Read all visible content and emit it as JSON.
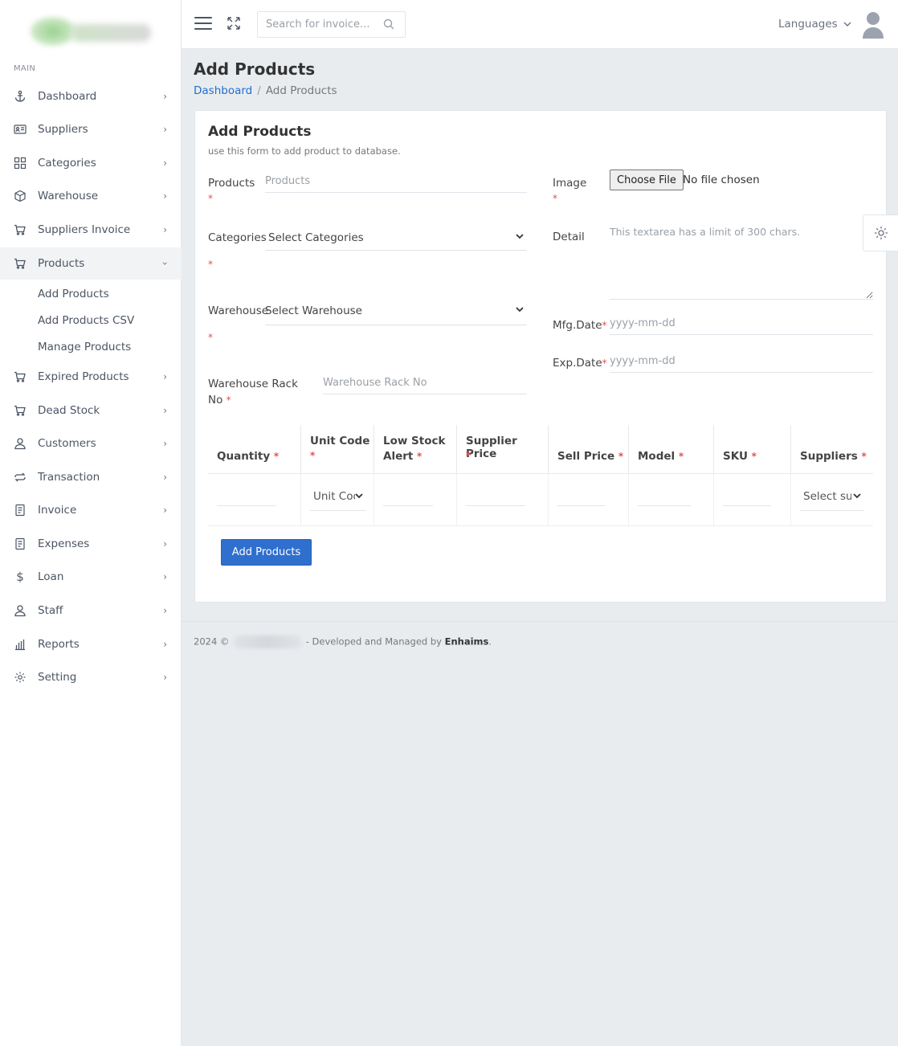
{
  "sidebar": {
    "section_label": "MAIN",
    "items": [
      {
        "label": "Dashboard",
        "icon": "anchor-icon"
      },
      {
        "label": "Suppliers",
        "icon": "id-card-icon"
      },
      {
        "label": "Categories",
        "icon": "grid-icon"
      },
      {
        "label": "Warehouse",
        "icon": "box-icon"
      },
      {
        "label": "Suppliers Invoice",
        "icon": "cart-icon"
      },
      {
        "label": "Products",
        "icon": "cart-icon"
      },
      {
        "label": "Expired Products",
        "icon": "cart-icon"
      },
      {
        "label": "Dead Stock",
        "icon": "cart-icon"
      },
      {
        "label": "Customers",
        "icon": "user-icon"
      },
      {
        "label": "Transaction",
        "icon": "transfer-icon"
      },
      {
        "label": "Invoice",
        "icon": "document-icon"
      },
      {
        "label": "Expenses",
        "icon": "document-icon"
      },
      {
        "label": "Loan",
        "icon": "dollar-icon"
      },
      {
        "label": "Staff",
        "icon": "user-icon"
      },
      {
        "label": "Reports",
        "icon": "bar-chart-icon"
      },
      {
        "label": "Setting",
        "icon": "gear-icon"
      }
    ],
    "products_submenu": [
      "Add Products",
      "Add Products CSV",
      "Manage Products"
    ]
  },
  "header": {
    "search_placeholder": "Search for invoice...",
    "languages_label": "Languages"
  },
  "page": {
    "title": "Add Products",
    "breadcrumb_home": "Dashboard",
    "breadcrumb_sep": "/",
    "breadcrumb_current": "Add Products"
  },
  "form": {
    "title": "Add Products",
    "subtitle": "use this form to add product to database.",
    "required_mark": "*",
    "products_label": "Products",
    "products_placeholder": "Products",
    "categories_label": "Categories",
    "categories_value": "Select Categories",
    "warehouse_label": "Warehouse",
    "warehouse_value": "Select Warehouse",
    "rack_label_1": "Warehouse Rack",
    "rack_label_2": "No",
    "rack_placeholder": "Warehouse Rack No",
    "image_label": "Image",
    "choose_file": "Choose File",
    "no_file": "No file chosen",
    "detail_label": "Detail",
    "detail_placeholder": "This textarea has a limit of 300 chars.",
    "mfg_label": "Mfg.Date",
    "exp_label": "Exp.Date",
    "date_placeholder": "yyyy-mm-dd",
    "submit_label": "Add Products"
  },
  "table": {
    "headers": [
      {
        "line1": "Quantity",
        "line2": ""
      },
      {
        "line1": "Unit Code",
        "line2": ""
      },
      {
        "line1": "Low Stock",
        "line2": "Alert"
      },
      {
        "line1": "Supplier Price",
        "line2": ""
      },
      {
        "line1": "Sell Price",
        "line2": ""
      },
      {
        "line1": "Model",
        "line2": ""
      },
      {
        "line1": "SKU",
        "line2": ""
      },
      {
        "line1": "Suppliers",
        "line2": ""
      }
    ],
    "unit_code_select": "Unit Code",
    "suppliers_select": "Select supplier"
  },
  "footer": {
    "prefix": "2024 ©",
    "suffix": "- Developed and Managed by",
    "brand": "Enhaims",
    "end": "."
  }
}
